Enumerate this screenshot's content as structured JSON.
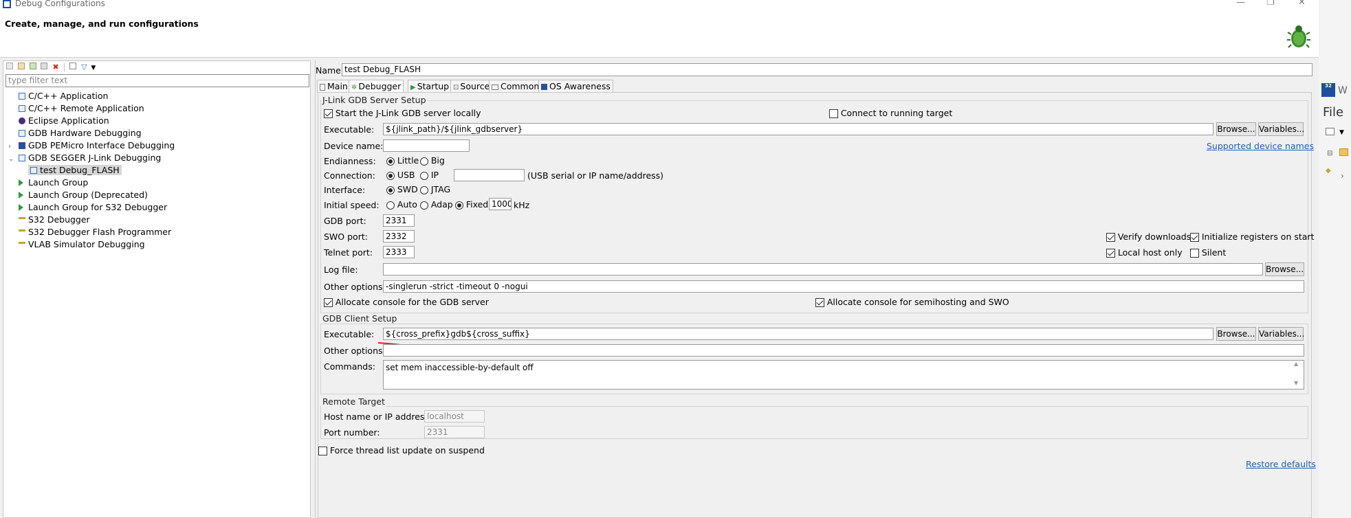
{
  "window": {
    "title": "Debug Configurations",
    "subtitle": "Create, manage, and run configurations"
  },
  "left": {
    "filter_placeholder": "type filter text",
    "tree": [
      {
        "label": "C/C++ Application",
        "icon": "c-app-icon",
        "color": "#3b6fb6"
      },
      {
        "label": "C/C++ Remote Application",
        "icon": "c-remote-icon",
        "color": "#3b6fb6"
      },
      {
        "label": "Eclipse Application",
        "icon": "eclipse-icon",
        "color": "#4b2b7f"
      },
      {
        "label": "GDB Hardware Debugging",
        "icon": "gdb-hw-icon",
        "color": "#3b6fb6"
      },
      {
        "label": "GDB PEMicro Interface Debugging",
        "icon": "pemicro-icon",
        "color": "#2a4f9e"
      },
      {
        "label": "GDB SEGGER J-Link Debugging",
        "icon": "jlink-icon",
        "color": "#3b6fb6"
      },
      {
        "label": "test Debug_FLASH",
        "icon": "config-icon",
        "color": "#3b6fb6"
      },
      {
        "label": "Launch Group",
        "icon": "launch-group-icon",
        "color": "#2e9b3b"
      },
      {
        "label": "Launch Group (Deprecated)",
        "icon": "launch-group-deprecated-icon",
        "color": "#2e9b3b"
      },
      {
        "label": "Launch Group for S32 Debugger",
        "icon": "launch-group-s32-icon",
        "color": "#2e9b3b"
      },
      {
        "label": "S32 Debugger",
        "icon": "s32-debugger-icon",
        "color": "#c9a227"
      },
      {
        "label": "S32 Debugger Flash Programmer",
        "icon": "s32-flash-icon",
        "color": "#c9a227"
      },
      {
        "label": "VLAB Simulator Debugging",
        "icon": "vlab-icon",
        "color": "#c9a227"
      }
    ]
  },
  "right": {
    "name_label": "Name:",
    "name_value": "test Debug_FLASH",
    "tabs": [
      "Main",
      "Debugger",
      "Startup",
      "Source",
      "Common",
      "OS Awareness"
    ],
    "server": {
      "group_title": "J-Link GDB Server Setup",
      "start_locally": "Start the J-Link GDB server locally",
      "connect_running": "Connect to running target",
      "executable_label": "Executable:",
      "executable_value": "${jlink_path}/${jlink_gdbserver}",
      "browse": "Browse...",
      "variables": "Variables...",
      "device_label": "Device name:",
      "supported_link": "Supported device names",
      "endianness_label": "Endianness:",
      "little": "Little",
      "big": "Big",
      "connection_label": "Connection:",
      "usb": "USB",
      "ip": "IP",
      "conn_hint": "(USB serial or IP name/address)",
      "interface_label": "Interface:",
      "swd": "SWD",
      "jtag": "JTAG",
      "speed_label": "Initial speed:",
      "auto": "Auto",
      "adap": "Adap",
      "fixed": "Fixed",
      "speed_value": "1000",
      "khz": "kHz",
      "gdb_port_label": "GDB port:",
      "gdb_port": "2331",
      "swo_port_label": "SWO port:",
      "swo_port": "2332",
      "telnet_port_label": "Telnet port:",
      "telnet_port": "2333",
      "verify_downloads": "Verify downloads",
      "init_registers": "Initialize registers on start",
      "local_host_only": "Local host only",
      "silent": "Silent",
      "log_label": "Log file:",
      "other_label": "Other options:",
      "other_value": "-singlerun -strict -timeout 0 -nogui",
      "alloc_console": "Allocate console for the GDB server",
      "alloc_semihost": "Allocate console for semihosting and SWO"
    },
    "client": {
      "group_title": "GDB Client Setup",
      "executable_label": "Executable:",
      "executable_value": "${cross_prefix}gdb${cross_suffix}",
      "browse": "Browse...",
      "variables": "Variables...",
      "other_label": "Other options:",
      "commands_label": "Commands:",
      "commands_value": "set mem inaccessible-by-default off"
    },
    "remote": {
      "group_title": "Remote Target",
      "host_label": "Host name or IP address:",
      "host_value": "localhost",
      "port_label": "Port number:",
      "port_value": "2331"
    },
    "force_thread": "Force thread list update on suspend",
    "restore_defaults": "Restore defaults"
  },
  "side": {
    "w": "W",
    "file": "File"
  }
}
